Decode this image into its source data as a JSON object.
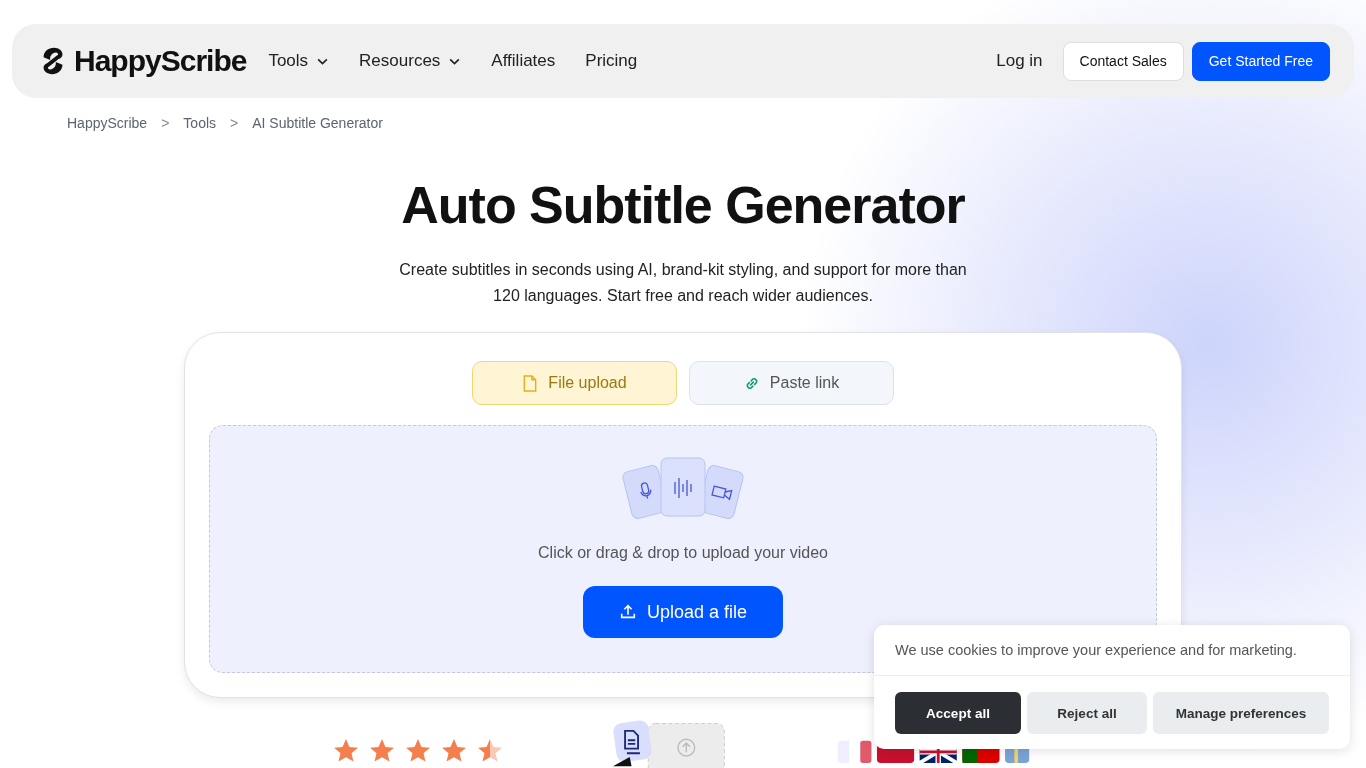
{
  "header": {
    "logo": "HappyScribe",
    "nav": [
      {
        "label": "Tools",
        "dropdown": true
      },
      {
        "label": "Resources",
        "dropdown": true
      },
      {
        "label": "Affiliates",
        "dropdown": false
      },
      {
        "label": "Pricing",
        "dropdown": false
      }
    ],
    "login": "Log in",
    "contact": "Contact Sales",
    "cta": "Get Started Free"
  },
  "breadcrumb": [
    "HappyScribe",
    "Tools",
    "AI Subtitle Generator"
  ],
  "breadcrumb_separator": ">",
  "hero": {
    "title": "Auto Subtitle Generator",
    "subtitle": "Create subtitles in seconds using AI, brand-kit styling, and support for more than 120 languages. Start free and reach wider audiences."
  },
  "tabs": [
    {
      "label": "File upload",
      "kind": "file",
      "selected": true
    },
    {
      "label": "Paste link",
      "kind": "link",
      "selected": false
    }
  ],
  "dropzone": {
    "hint": "Click or drag & drop to upload your video",
    "button": "Upload a file"
  },
  "rating": {
    "stars": 4.5
  },
  "cookie": {
    "message": "We use cookies to improve your experience and for marketing.",
    "buttons": [
      {
        "label": "Accept all",
        "kind": "primary"
      },
      {
        "label": "Reject all",
        "kind": "secondary"
      },
      {
        "label": "Manage preferences",
        "kind": "secondary"
      }
    ]
  }
}
